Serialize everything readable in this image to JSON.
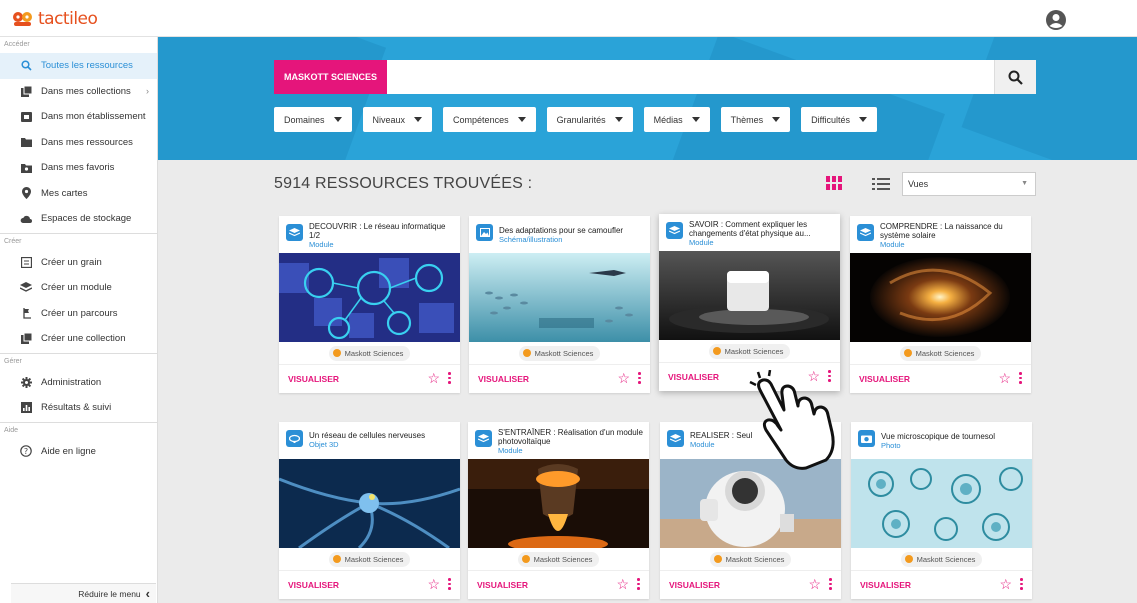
{
  "app": {
    "logo_text": "tactileo"
  },
  "sidebar": {
    "sections": {
      "access": "Accéder",
      "create": "Créer",
      "manage": "Gérer",
      "help": "Aide"
    },
    "access_items": [
      {
        "label": "Toutes les ressources",
        "icon": "search-icon"
      },
      {
        "label": "Dans mes collections",
        "icon": "collection-icon"
      },
      {
        "label": "Dans mon établissement",
        "icon": "school-icon"
      },
      {
        "label": "Dans mes ressources",
        "icon": "folder-icon"
      },
      {
        "label": "Dans mes favoris",
        "icon": "favorite-folder-icon"
      },
      {
        "label": "Mes cartes",
        "icon": "map-pin-icon"
      },
      {
        "label": "Espaces de stockage",
        "icon": "cloud-icon"
      }
    ],
    "create_items": [
      {
        "label": "Créer un grain",
        "icon": "grain-icon"
      },
      {
        "label": "Créer un module",
        "icon": "layers-icon"
      },
      {
        "label": "Créer un parcours",
        "icon": "path-icon"
      },
      {
        "label": "Créer une collection",
        "icon": "collection-icon"
      }
    ],
    "manage_items": [
      {
        "label": "Administration",
        "icon": "gear-icon"
      },
      {
        "label": "Résultats & suivi",
        "icon": "chart-icon"
      }
    ],
    "help_items": [
      {
        "label": "Aide en ligne",
        "icon": "help-icon"
      }
    ],
    "collapse_label": "Réduire le menu"
  },
  "search": {
    "tag": "MASKOTT SCIENCES",
    "value": ""
  },
  "filters": [
    "Domaines",
    "Niveaux",
    "Compétences",
    "Granularités",
    "Médias",
    "Thèmes",
    "Difficultés"
  ],
  "results": {
    "count_label": "5914 RESSOURCES TROUVÉES :",
    "sort_value": "Vues"
  },
  "cards": [
    {
      "title": "DECOUVRIR : Le réseau informatique 1/2",
      "type": "Module",
      "publisher": "Maskott Sciences",
      "action": "VISUALISER",
      "icon": "module-icon"
    },
    {
      "title": "Des adaptations pour se camoufler",
      "type": "Schéma/illustration",
      "publisher": "Maskott Sciences",
      "action": "VISUALISER",
      "icon": "image-icon"
    },
    {
      "title": "SAVOIR : Comment expliquer les changements d'état physique au...",
      "type": "Module",
      "publisher": "Maskott Sciences",
      "action": "VISUALISER",
      "icon": "module-icon"
    },
    {
      "title": "COMPRENDRE : La naissance du système solaire",
      "type": "Module",
      "publisher": "Maskott Sciences",
      "action": "VISUALISER",
      "icon": "module-icon"
    },
    {
      "title": "Un réseau de cellules nerveuses",
      "type": "Objet 3D",
      "publisher": "Maskott Sciences",
      "action": "VISUALISER",
      "icon": "3d-object-icon"
    },
    {
      "title": "S'ENTRAÎNER : Réalisation d'un module photovoltaïque",
      "type": "Module",
      "publisher": "Maskott Sciences",
      "action": "VISUALISER",
      "icon": "module-icon"
    },
    {
      "title": "REALISER : Seul",
      "type": "Module",
      "publisher": "Maskott Sciences",
      "action": "VISUALISER",
      "icon": "module-icon"
    },
    {
      "title": "Vue microscopique de tournesol",
      "type": "Photo",
      "publisher": "Maskott Sciences",
      "action": "VISUALISER",
      "icon": "camera-icon"
    }
  ],
  "colors": {
    "brand_pink": "#e5157b",
    "hero_blue": "#2aa3d8",
    "link_blue": "#2b8fd6",
    "logo_orange": "#e6501e"
  }
}
